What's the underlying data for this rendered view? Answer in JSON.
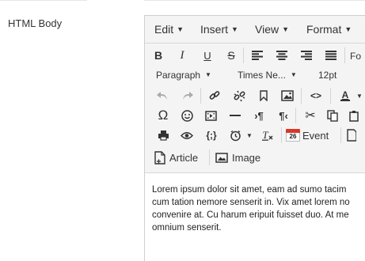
{
  "field": {
    "label": "HTML Body"
  },
  "menubar": {
    "edit": "Edit",
    "insert": "Insert",
    "view": "View",
    "format": "Format"
  },
  "toolbar": {
    "fontsize_partial": "Fo",
    "block_format": "Paragraph",
    "font_family": "Times Ne...",
    "font_size": "12pt",
    "calendar_day": "26",
    "event_label": "Event",
    "article_label": "Article",
    "image_label": "Image"
  },
  "content": {
    "lines": [
      "Lorem ipsum dolor sit amet, eam ad sumo tacim",
      "cum tation nemore senserit in. Vix amet lorem no",
      "convenire at. Cu harum eripuit fuisset duo. At me",
      "omnium senserit."
    ]
  },
  "colors": {
    "toolbar_bg": "#f4f4f4",
    "border": "#cfcfcf",
    "calendar_red": "#d9372b"
  }
}
